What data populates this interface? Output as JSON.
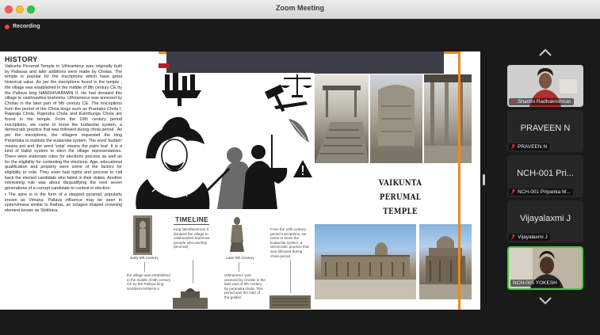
{
  "window": {
    "title": "Zoom Meeting"
  },
  "recording": {
    "label": "Recording"
  },
  "slide": {
    "history_title": "HISTORY",
    "history_paragraph_1": "Vaikunta Perumal Temple in Uthiramerur was originally built by Pallavas and later additions were made by Cholas. The temple is popular for the inscriptions which have great historical value. As per the inscriptions found in the temple , the village was established in the middle of 8th century CE by the Pallava king NANDHIVARMAN II. He had donated this village to vaishnavites brahmins. Uthiramerur was annexed by Cholas in the later part of 9th century CE. The inscriptions from the period of the Chola kings such as Prantaka Chola I, Rajaraja Chola, Rajendra Chola and Kulothunga Chola are found in the temple. From the 10th century period inscriptions, we came to know the kudavolai system, a democratic practice that was followed during chola period . As per the inscriptions, the villagers requested the king Parantaka to institute the kudavolai system. The word 'kudam' means pot and the word 'volai' means the palm leaf. It is a kind of ballot system to elect the village representatives. There were elaborate rules for elections process as well as for the eligibility for contesting the elections. Age, educational qualification and property were some of the factors for eligibility to vote. They even had rights and process to call back the elected candidate who failed in their duties. Another interesting rule was about disqualifying the next seven generations of a corrupt candidate to contest in election.",
    "history_paragraph_2": "• The spire is in the form of a stepped pyramid, popularly known as Vimana. Pallava influence may be seen in spire/vimana similar to Rathas, an octagon shaped crowning element known as Shikhara.",
    "temple_title_line1": "VAIKUNTA PERUMAL",
    "temple_title_line2": "TEMPLE",
    "timeline_title": "TIMELINE",
    "timeline_early_caption": "Early 8th Century",
    "timeline_early_text": "the village was established in the middle of 8th century CE by the Pallava king NANDHIVARMAN II.",
    "timeline_king_text": "King Nandhivarman II donated the village to vaishnavites brahmins (people who worship perumal).",
    "timeline_later_caption": "Later 9th Century",
    "timeline_later_text": "Uthiramerur was annexed by Cholas in the later part of 9th century by paranaka chola. This period was the start of the golden",
    "timeline_10th_text": "From the 10th century period inscriptions, we came to know the kudavolai system, a democratic practice that was followed during chola period."
  },
  "participants": [
    {
      "display": "",
      "label": "Shanthi Radhakrishnan",
      "video": true
    },
    {
      "display": "PRAVEEN N",
      "label": "PRAVEEN N",
      "video": false
    },
    {
      "display": "NCH-001 Pri...",
      "label": "NCH-001 Priyanka M...",
      "video": false
    },
    {
      "display": "Vijayalaxmi J",
      "label": "Vijayalaxmi J",
      "video": false
    },
    {
      "display": "",
      "label": "NCH-005 YOKESH",
      "video": true,
      "active": true
    }
  ],
  "colors": {
    "accent_orange": "#f08a1c",
    "active_speaker": "#3fcf3f",
    "recording_red": "#e8453c"
  }
}
